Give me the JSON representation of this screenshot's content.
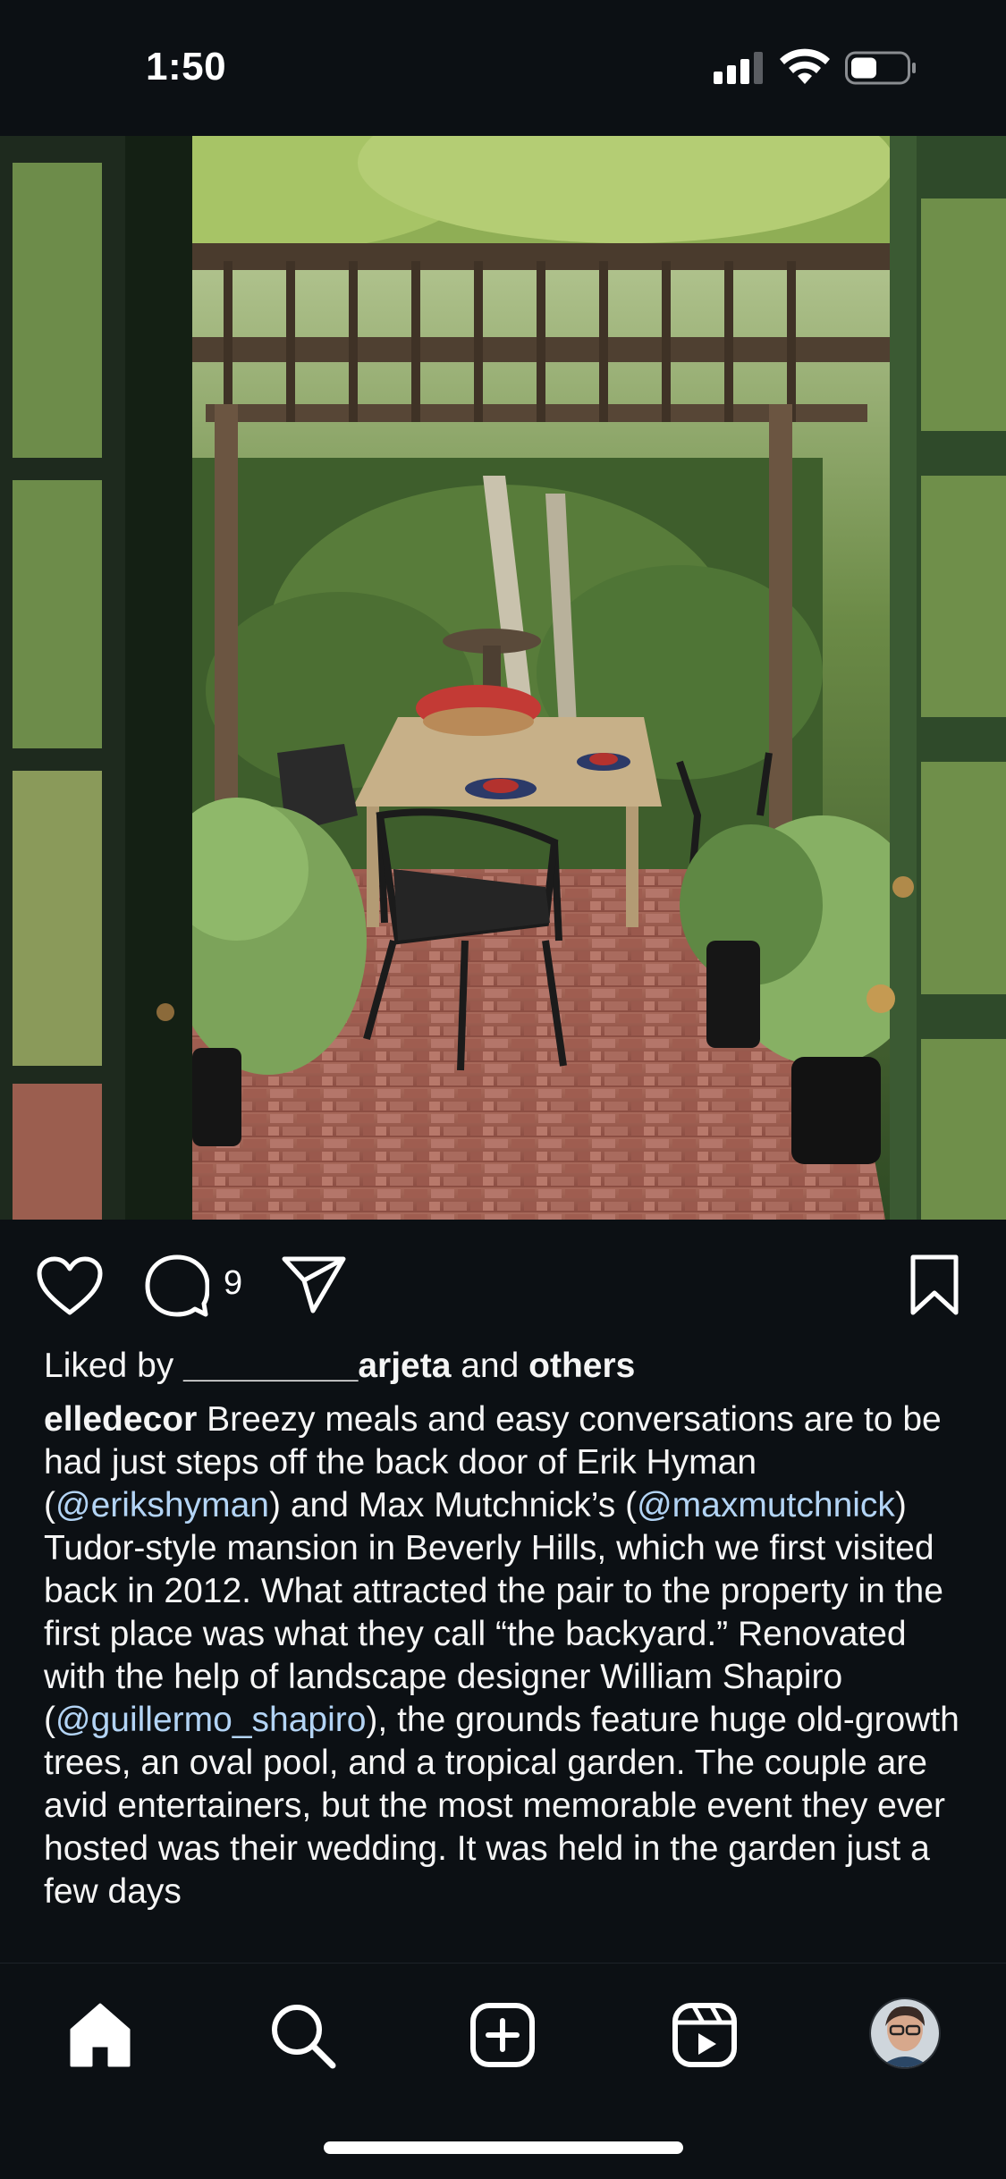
{
  "status_bar": {
    "time": "1:50"
  },
  "post": {
    "comment_count": "9",
    "likes": {
      "prefix": "Liked by ",
      "redacted_user": "_________",
      "user": "arjeta",
      "middle": " and ",
      "others": "others"
    },
    "caption": {
      "username": "elledecor",
      "part1": " Breezy meals and easy conversations are to be had just steps off the back door of Erik Hyman (",
      "mention1": "@erikshyman",
      "part2": ") and Max Mutchnick’s (",
      "mention2": "@maxmutchnick",
      "part3": ") Tudor-style mansion in Beverly Hills, which we first visited back in 2012. What attracted the pair to the property in the first place was what they call “the backyard.” Renovated with the help of landscape designer William Shapiro (",
      "mention3": "@guillermo_shapiro",
      "part4": "), the grounds feature huge old-growth trees, an oval pool, and a tropical garden. The couple are avid entertainers, but the most memorable event they ever hosted was their wedding. It was held in the garden just a few days"
    }
  },
  "tabs": [
    "home-icon",
    "search-icon",
    "create-icon",
    "reels-icon",
    "profile-avatar"
  ],
  "colors": {
    "background": "#0c1014",
    "text": "#f5f5f5",
    "mention": "#b3d4f5"
  }
}
